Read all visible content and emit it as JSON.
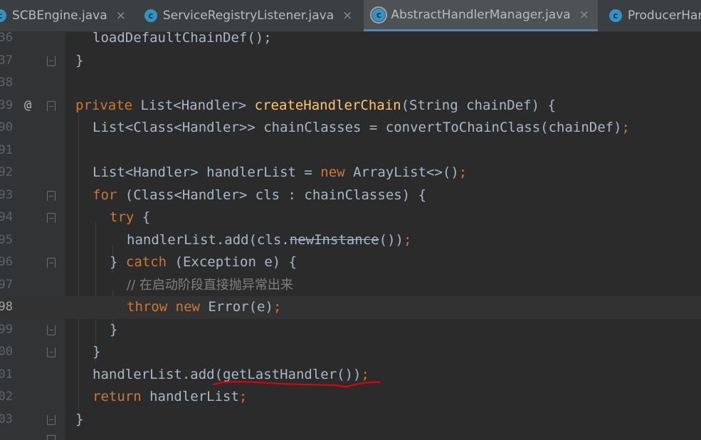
{
  "tabs": [
    {
      "label": "SCBEngine.java",
      "close": "×"
    },
    {
      "label": "ServiceRegistryListener.java",
      "close": "×"
    },
    {
      "label": "AbstractHandlerManager.java",
      "close": "×"
    },
    {
      "label": "ProducerHan"
    }
  ],
  "tab_icon_letter": "c",
  "gutter": {
    "line_numbers": [
      "36",
      "37",
      "38",
      "39",
      "90",
      "91",
      "92",
      "93",
      "94",
      "95",
      "96",
      "97",
      "98",
      "99",
      "00",
      "01",
      "02",
      "03"
    ],
    "override_marker": "@"
  },
  "code": {
    "l0_a": "loadDefaultChainDef",
    "l0_b": "();",
    "l1": "}",
    "l3_kw": "private",
    "l3_a": " List<Handler> ",
    "l3_fn": "createHandlerChain",
    "l3_b": "(String chainDef) {",
    "l4_a": "List<Class<Handler>> chainClasses = convertToChainClass(chainDef)",
    "l4_b": ";",
    "l6_a": "List<Handler> handlerList = ",
    "l6_kw": "new",
    "l6_b": " ArrayList<>()",
    "l6_c": ";",
    "l7_kw": "for",
    "l7_a": " (Class<Handler> cls : chainClasses) {",
    "l8_kw": "try",
    "l8_a": " {",
    "l9_a": "handlerList.add(cls.",
    "l9_strike": "newInstance",
    "l9_b": "())",
    "l9_c": ";",
    "l10_a": "} ",
    "l10_kw": "catch",
    "l10_b": " (Exception e) {",
    "l11_cm": "// 在启动阶段直接抛异常出来",
    "l12_kw1": "throw",
    "l12_sp": " ",
    "l12_kw2": "new",
    "l12_a": " Error(e)",
    "l12_b": ";",
    "l13": "}",
    "l14": "}",
    "l15_a": "handlerList.add(getLastHandler())",
    "l15_b": ";",
    "l16_kw": "return",
    "l16_a": " handlerList",
    "l16_b": ";",
    "l17": "}"
  },
  "colors": {
    "background": "#2b2b2b",
    "keyword": "#cc7832",
    "method_declaration": "#ffc66d",
    "default_text": "#a9b7c6",
    "comment": "#808080",
    "annotation_underline": "#e0000d"
  }
}
